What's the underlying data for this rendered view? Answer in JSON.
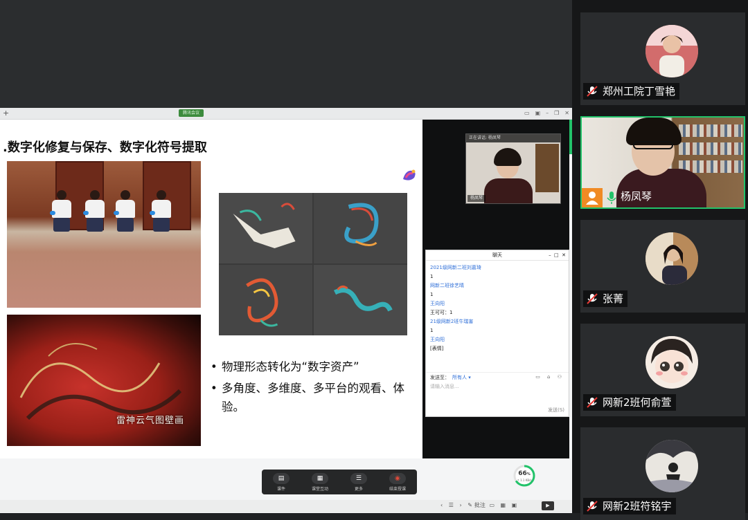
{
  "meeting": {
    "share_badge": "腾讯会议"
  },
  "slide": {
    "title": ".数字化修复与保存、数字化符号提取",
    "photo_caption": "雷神云气图壁画",
    "bullets": [
      "物理形态转化为“数字资产”",
      "多角度、多维度、多平台的观看、体验。"
    ]
  },
  "mini_video": {
    "talking": "正在讲话: 杨凤琴",
    "name": "杨凤琴"
  },
  "chat": {
    "title": "聊天",
    "messages": [
      {
        "text": "2021级网新二班刘嘉琦",
        "type": "name"
      },
      {
        "text": "1",
        "type": "msg"
      },
      {
        "text": "网新二班徐艺晴",
        "type": "name"
      },
      {
        "text": "1",
        "type": "msg"
      },
      {
        "text": "王向阳",
        "type": "name"
      },
      {
        "text": "王可可：1",
        "type": "msg"
      },
      {
        "text": "21级网新2班牛瑞害",
        "type": "name"
      },
      {
        "text": "1",
        "type": "msg"
      },
      {
        "text": "王向阳",
        "type": "name"
      },
      {
        "text": "[表情]",
        "type": "msg"
      }
    ],
    "send_label": "发送至：",
    "send_to": "所有人",
    "placeholder": "请输入消息...",
    "send_button": "发送(S)"
  },
  "toolbar": {
    "items": [
      {
        "label": "课件",
        "icon": "courseware-icon"
      },
      {
        "label": "课堂互动",
        "icon": "interaction-icon"
      },
      {
        "label": "更多",
        "icon": "more-icon"
      },
      {
        "label": "结束授课",
        "icon": "end-class-icon"
      }
    ]
  },
  "meter": {
    "percent": 66,
    "percent_text": "66",
    "unit": "%",
    "sub": "↑ 1.1 KB/s"
  },
  "footer": {
    "nav": "‹ ☰ ›",
    "note": "批注"
  },
  "participants": [
    {
      "name": "郑州工院丁雪艳",
      "muted": true
    },
    {
      "name": "杨凤琴",
      "muted": false,
      "speaking": true
    },
    {
      "name": "张菁",
      "muted": true
    },
    {
      "name": "网新2班何俞萱",
      "muted": true
    },
    {
      "name": "网新2班符铭宇",
      "muted": true
    }
  ],
  "colors": {
    "accent_green": "#22c36a",
    "chat_name_blue": "#2f6fd8",
    "user_badge_orange": "#f08a24"
  }
}
